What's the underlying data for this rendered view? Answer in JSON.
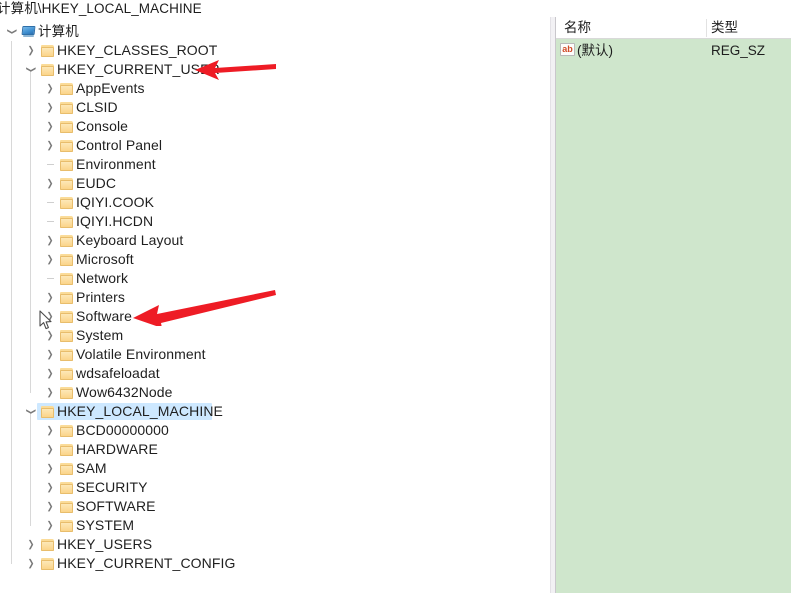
{
  "window": {
    "path_bar": "计算机\\HKEY_LOCAL_MACHINE"
  },
  "tree": {
    "root": {
      "label": "计算机",
      "icon": "computer-monitor-icon",
      "state": "expanded"
    },
    "items": [
      {
        "label": "计算机",
        "depth": 0,
        "state": "expanded",
        "icon": "computer-monitor-icon",
        "selected": false
      },
      {
        "label": "HKEY_CLASSES_ROOT",
        "depth": 1,
        "state": "collapsed",
        "icon": "folder-icon",
        "selected": false
      },
      {
        "label": "HKEY_CURRENT_USER",
        "depth": 1,
        "state": "expanded",
        "icon": "folder-icon",
        "selected": false
      },
      {
        "label": "AppEvents",
        "depth": 2,
        "state": "collapsed",
        "icon": "folder-icon",
        "selected": false
      },
      {
        "label": "CLSID",
        "depth": 2,
        "state": "collapsed",
        "icon": "folder-icon",
        "selected": false
      },
      {
        "label": "Console",
        "depth": 2,
        "state": "collapsed",
        "icon": "folder-icon",
        "selected": false
      },
      {
        "label": "Control Panel",
        "depth": 2,
        "state": "collapsed",
        "icon": "folder-icon",
        "selected": false
      },
      {
        "label": "Environment",
        "depth": 2,
        "state": "leaf",
        "icon": "folder-icon",
        "selected": false
      },
      {
        "label": "EUDC",
        "depth": 2,
        "state": "collapsed",
        "icon": "folder-icon",
        "selected": false
      },
      {
        "label": "IQIYI.COOK",
        "depth": 2,
        "state": "leaf",
        "icon": "folder-icon",
        "selected": false
      },
      {
        "label": "IQIYI.HCDN",
        "depth": 2,
        "state": "leaf",
        "icon": "folder-icon",
        "selected": false
      },
      {
        "label": "Keyboard Layout",
        "depth": 2,
        "state": "collapsed",
        "icon": "folder-icon",
        "selected": false
      },
      {
        "label": "Microsoft",
        "depth": 2,
        "state": "collapsed",
        "icon": "folder-icon",
        "selected": false
      },
      {
        "label": "Network",
        "depth": 2,
        "state": "leaf",
        "icon": "folder-icon",
        "selected": false
      },
      {
        "label": "Printers",
        "depth": 2,
        "state": "collapsed",
        "icon": "folder-icon",
        "selected": false
      },
      {
        "label": "Software",
        "depth": 2,
        "state": "collapsed",
        "icon": "folder-icon",
        "selected": false
      },
      {
        "label": "System",
        "depth": 2,
        "state": "collapsed",
        "icon": "folder-icon",
        "selected": false
      },
      {
        "label": "Volatile Environment",
        "depth": 2,
        "state": "collapsed",
        "icon": "folder-icon",
        "selected": false
      },
      {
        "label": "wdsafeloadat",
        "depth": 2,
        "state": "collapsed",
        "icon": "folder-icon",
        "selected": false
      },
      {
        "label": "Wow6432Node",
        "depth": 2,
        "state": "collapsed",
        "icon": "folder-icon",
        "selected": false
      },
      {
        "label": "HKEY_LOCAL_MACHINE",
        "depth": 1,
        "state": "expanded",
        "icon": "folder-icon",
        "selected": true
      },
      {
        "label": "BCD00000000",
        "depth": 2,
        "state": "collapsed",
        "icon": "folder-icon",
        "selected": false
      },
      {
        "label": "HARDWARE",
        "depth": 2,
        "state": "collapsed",
        "icon": "folder-icon",
        "selected": false
      },
      {
        "label": "SAM",
        "depth": 2,
        "state": "collapsed",
        "icon": "folder-icon",
        "selected": false
      },
      {
        "label": "SECURITY",
        "depth": 2,
        "state": "collapsed",
        "icon": "folder-icon",
        "selected": false
      },
      {
        "label": "SOFTWARE",
        "depth": 2,
        "state": "collapsed",
        "icon": "folder-icon",
        "selected": false
      },
      {
        "label": "SYSTEM",
        "depth": 2,
        "state": "collapsed",
        "icon": "folder-icon",
        "selected": false
      },
      {
        "label": "HKEY_USERS",
        "depth": 1,
        "state": "collapsed",
        "icon": "folder-icon",
        "selected": false
      },
      {
        "label": "HKEY_CURRENT_CONFIG",
        "depth": 1,
        "state": "collapsed",
        "icon": "folder-icon",
        "selected": false
      }
    ]
  },
  "values": {
    "columns": [
      "名称",
      "类型"
    ],
    "rows": [
      {
        "icon": "string-value-icon",
        "name": "(默认)",
        "type": "REG_SZ"
      }
    ]
  },
  "annotations": [
    {
      "name": "arrow-to-hkey-current-user",
      "color": "#ee1c25"
    },
    {
      "name": "arrow-to-software",
      "color": "#ee1c25"
    }
  ],
  "colors": {
    "selection": "#cde8ff",
    "value_pane_background": "#cfe6cc",
    "annotation_red": "#ee1c25",
    "folder_yellow": "#f8d184"
  }
}
